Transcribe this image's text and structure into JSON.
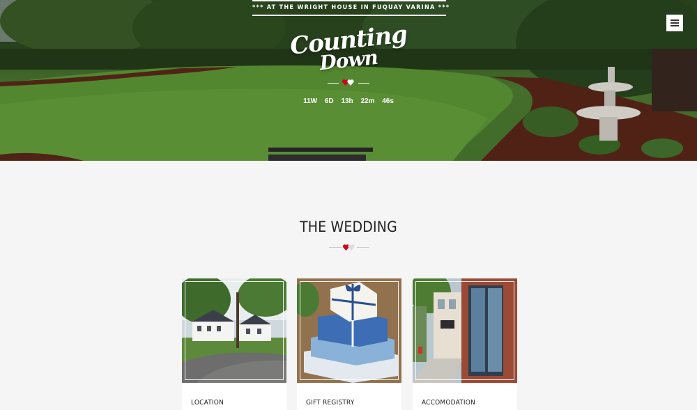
{
  "hero": {
    "tagline": "*** AT THE WRIGHT HOUSE IN FUQUAY VARINA ***",
    "logo_line1": "Counting",
    "logo_line2": "Down",
    "countdown": {
      "weeks": "11W",
      "days": "6D",
      "hours": "13h",
      "minutes": "22m",
      "seconds": "46s"
    },
    "menu_icon": "hamburger-icon"
  },
  "wedding": {
    "title": "THE WEDDING",
    "cards": [
      {
        "label": "LOCATION",
        "image": "house-photo"
      },
      {
        "label": "GIFT REGISTRY",
        "image": "gift-boxes-photo"
      },
      {
        "label": "ACCOMODATION",
        "image": "storefront-street-photo"
      }
    ]
  },
  "colors": {
    "heart_red": "#d0021b",
    "page_bg": "#f5f5f5",
    "text_dark": "#222222"
  }
}
